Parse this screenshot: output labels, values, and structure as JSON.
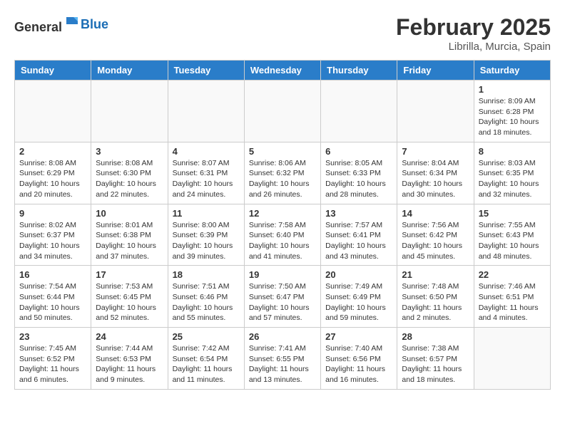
{
  "header": {
    "logo_general": "General",
    "logo_blue": "Blue",
    "month_year": "February 2025",
    "location": "Librilla, Murcia, Spain"
  },
  "days_of_week": [
    "Sunday",
    "Monday",
    "Tuesday",
    "Wednesday",
    "Thursday",
    "Friday",
    "Saturday"
  ],
  "weeks": [
    [
      {
        "day": "",
        "info": ""
      },
      {
        "day": "",
        "info": ""
      },
      {
        "day": "",
        "info": ""
      },
      {
        "day": "",
        "info": ""
      },
      {
        "day": "",
        "info": ""
      },
      {
        "day": "",
        "info": ""
      },
      {
        "day": "1",
        "info": "Sunrise: 8:09 AM\nSunset: 6:28 PM\nDaylight: 10 hours\nand 18 minutes."
      }
    ],
    [
      {
        "day": "2",
        "info": "Sunrise: 8:08 AM\nSunset: 6:29 PM\nDaylight: 10 hours\nand 20 minutes."
      },
      {
        "day": "3",
        "info": "Sunrise: 8:08 AM\nSunset: 6:30 PM\nDaylight: 10 hours\nand 22 minutes."
      },
      {
        "day": "4",
        "info": "Sunrise: 8:07 AM\nSunset: 6:31 PM\nDaylight: 10 hours\nand 24 minutes."
      },
      {
        "day": "5",
        "info": "Sunrise: 8:06 AM\nSunset: 6:32 PM\nDaylight: 10 hours\nand 26 minutes."
      },
      {
        "day": "6",
        "info": "Sunrise: 8:05 AM\nSunset: 6:33 PM\nDaylight: 10 hours\nand 28 minutes."
      },
      {
        "day": "7",
        "info": "Sunrise: 8:04 AM\nSunset: 6:34 PM\nDaylight: 10 hours\nand 30 minutes."
      },
      {
        "day": "8",
        "info": "Sunrise: 8:03 AM\nSunset: 6:35 PM\nDaylight: 10 hours\nand 32 minutes."
      }
    ],
    [
      {
        "day": "9",
        "info": "Sunrise: 8:02 AM\nSunset: 6:37 PM\nDaylight: 10 hours\nand 34 minutes."
      },
      {
        "day": "10",
        "info": "Sunrise: 8:01 AM\nSunset: 6:38 PM\nDaylight: 10 hours\nand 37 minutes."
      },
      {
        "day": "11",
        "info": "Sunrise: 8:00 AM\nSunset: 6:39 PM\nDaylight: 10 hours\nand 39 minutes."
      },
      {
        "day": "12",
        "info": "Sunrise: 7:58 AM\nSunset: 6:40 PM\nDaylight: 10 hours\nand 41 minutes."
      },
      {
        "day": "13",
        "info": "Sunrise: 7:57 AM\nSunset: 6:41 PM\nDaylight: 10 hours\nand 43 minutes."
      },
      {
        "day": "14",
        "info": "Sunrise: 7:56 AM\nSunset: 6:42 PM\nDaylight: 10 hours\nand 45 minutes."
      },
      {
        "day": "15",
        "info": "Sunrise: 7:55 AM\nSunset: 6:43 PM\nDaylight: 10 hours\nand 48 minutes."
      }
    ],
    [
      {
        "day": "16",
        "info": "Sunrise: 7:54 AM\nSunset: 6:44 PM\nDaylight: 10 hours\nand 50 minutes."
      },
      {
        "day": "17",
        "info": "Sunrise: 7:53 AM\nSunset: 6:45 PM\nDaylight: 10 hours\nand 52 minutes."
      },
      {
        "day": "18",
        "info": "Sunrise: 7:51 AM\nSunset: 6:46 PM\nDaylight: 10 hours\nand 55 minutes."
      },
      {
        "day": "19",
        "info": "Sunrise: 7:50 AM\nSunset: 6:47 PM\nDaylight: 10 hours\nand 57 minutes."
      },
      {
        "day": "20",
        "info": "Sunrise: 7:49 AM\nSunset: 6:49 PM\nDaylight: 10 hours\nand 59 minutes."
      },
      {
        "day": "21",
        "info": "Sunrise: 7:48 AM\nSunset: 6:50 PM\nDaylight: 11 hours\nand 2 minutes."
      },
      {
        "day": "22",
        "info": "Sunrise: 7:46 AM\nSunset: 6:51 PM\nDaylight: 11 hours\nand 4 minutes."
      }
    ],
    [
      {
        "day": "23",
        "info": "Sunrise: 7:45 AM\nSunset: 6:52 PM\nDaylight: 11 hours\nand 6 minutes."
      },
      {
        "day": "24",
        "info": "Sunrise: 7:44 AM\nSunset: 6:53 PM\nDaylight: 11 hours\nand 9 minutes."
      },
      {
        "day": "25",
        "info": "Sunrise: 7:42 AM\nSunset: 6:54 PM\nDaylight: 11 hours\nand 11 minutes."
      },
      {
        "day": "26",
        "info": "Sunrise: 7:41 AM\nSunset: 6:55 PM\nDaylight: 11 hours\nand 13 minutes."
      },
      {
        "day": "27",
        "info": "Sunrise: 7:40 AM\nSunset: 6:56 PM\nDaylight: 11 hours\nand 16 minutes."
      },
      {
        "day": "28",
        "info": "Sunrise: 7:38 AM\nSunset: 6:57 PM\nDaylight: 11 hours\nand 18 minutes."
      },
      {
        "day": "",
        "info": ""
      }
    ]
  ]
}
